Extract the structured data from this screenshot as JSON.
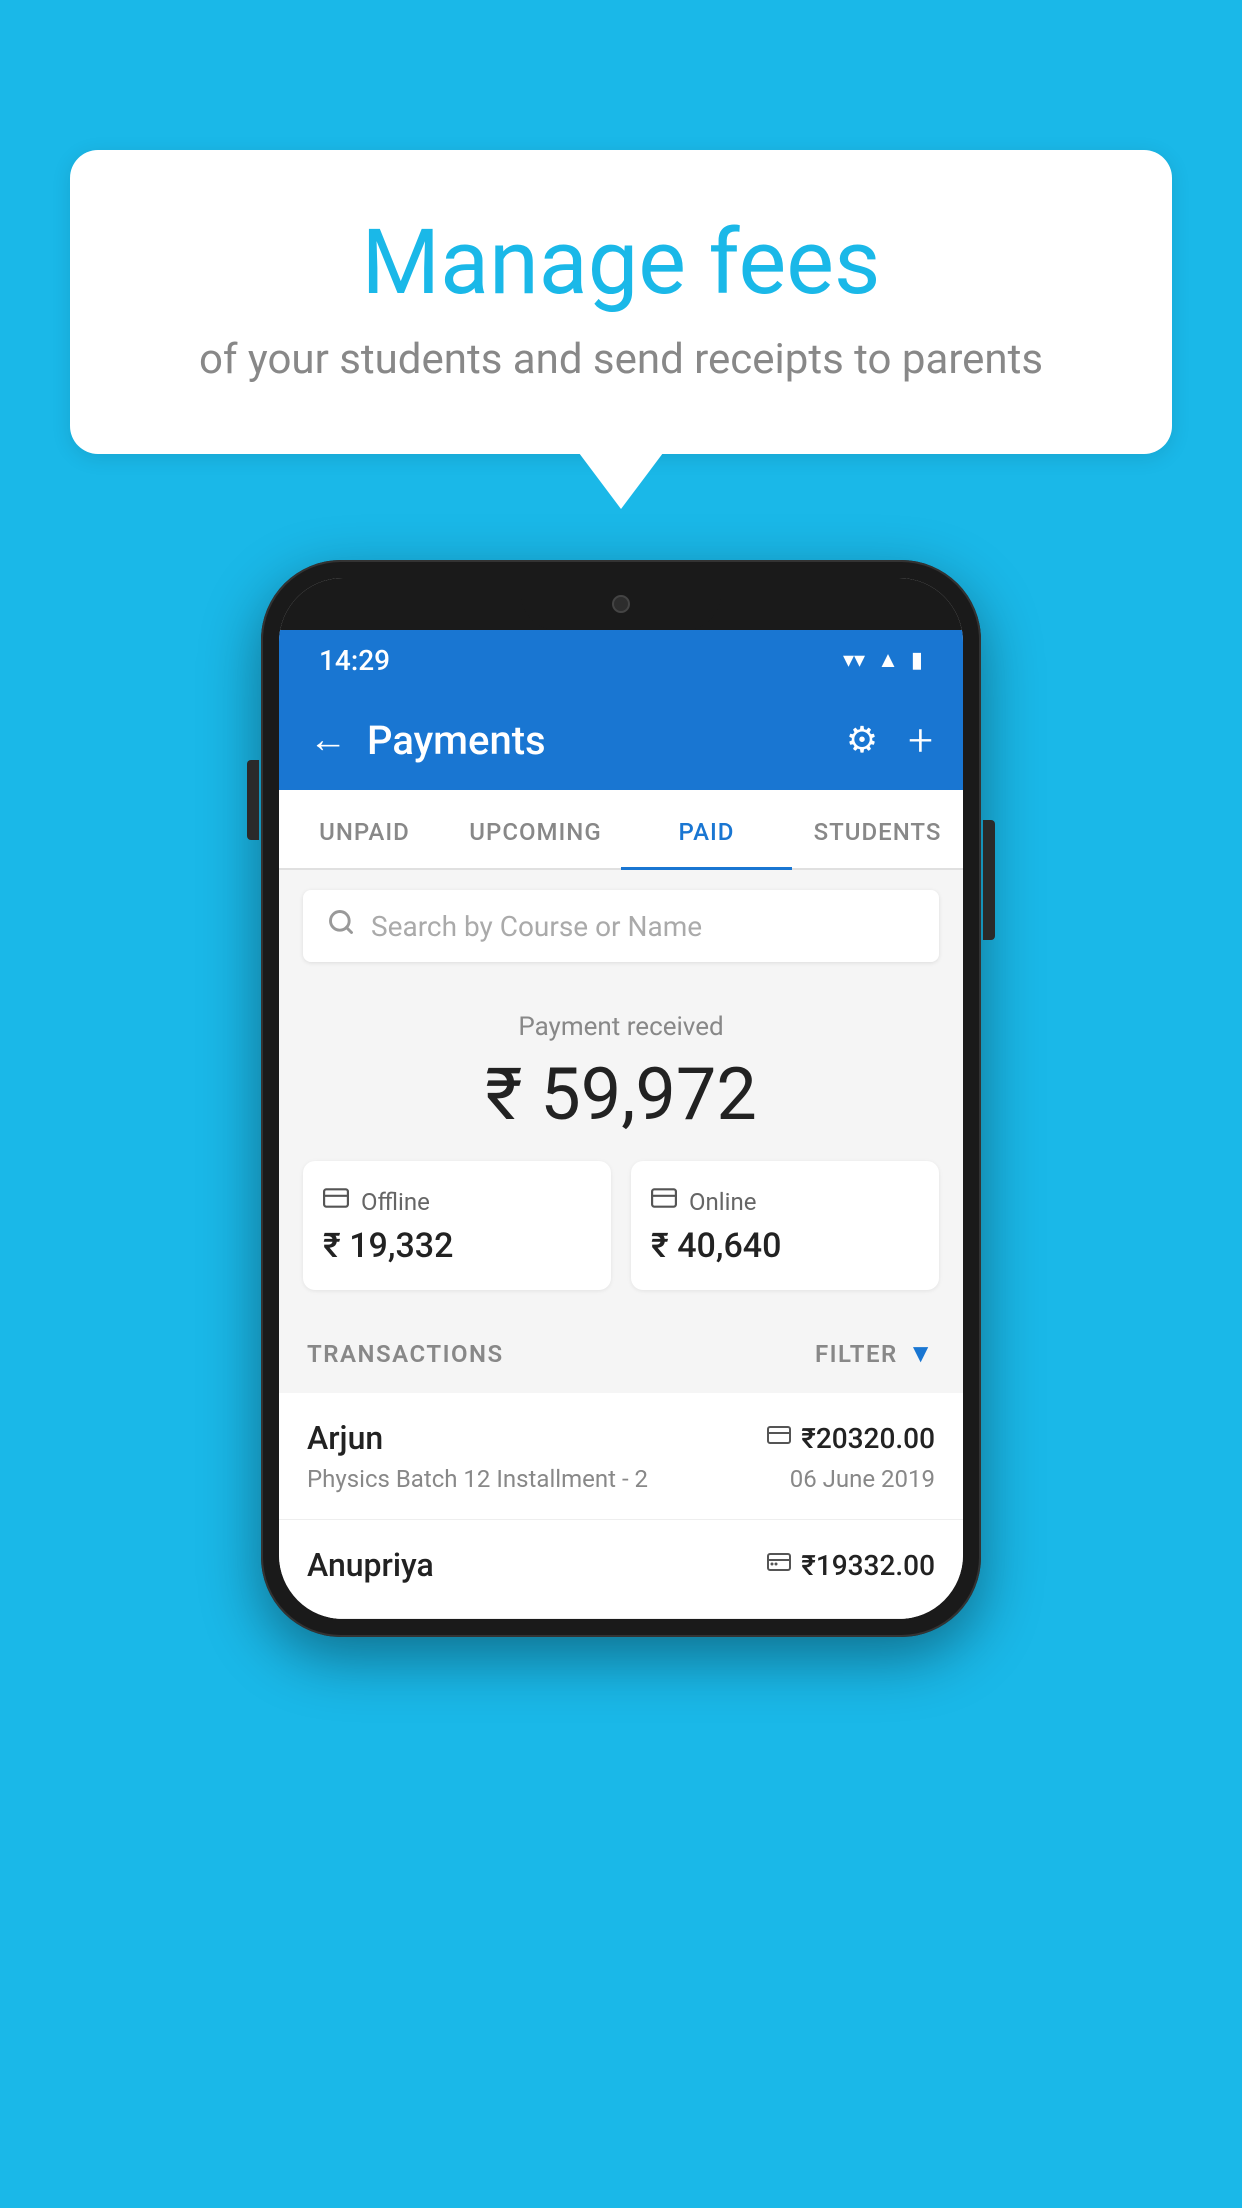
{
  "background_color": "#1ab8e8",
  "speech_bubble": {
    "title": "Manage fees",
    "subtitle": "of your students and send receipts to parents"
  },
  "status_bar": {
    "time": "14:29",
    "wifi_icon": "▼",
    "signal_icon": "▲",
    "battery_icon": "▮"
  },
  "header": {
    "back_label": "←",
    "title": "Payments",
    "gear_label": "⚙",
    "plus_label": "+"
  },
  "tabs": [
    {
      "label": "UNPAID",
      "active": false
    },
    {
      "label": "UPCOMING",
      "active": false
    },
    {
      "label": "PAID",
      "active": true
    },
    {
      "label": "STUDENTS",
      "active": false
    }
  ],
  "search": {
    "placeholder": "Search by Course or Name"
  },
  "payment_summary": {
    "label": "Payment received",
    "total_amount": "₹ 59,972",
    "offline": {
      "label": "Offline",
      "amount": "₹ 19,332"
    },
    "online": {
      "label": "Online",
      "amount": "₹ 40,640"
    }
  },
  "transactions": {
    "section_label": "TRANSACTIONS",
    "filter_label": "FILTER",
    "items": [
      {
        "name": "Arjun",
        "amount": "₹20320.00",
        "course": "Physics Batch 12 Installment - 2",
        "date": "06 June 2019",
        "payment_type": "online"
      },
      {
        "name": "Anupriya",
        "amount": "₹19332.00",
        "course": "",
        "date": "",
        "payment_type": "offline"
      }
    ]
  }
}
